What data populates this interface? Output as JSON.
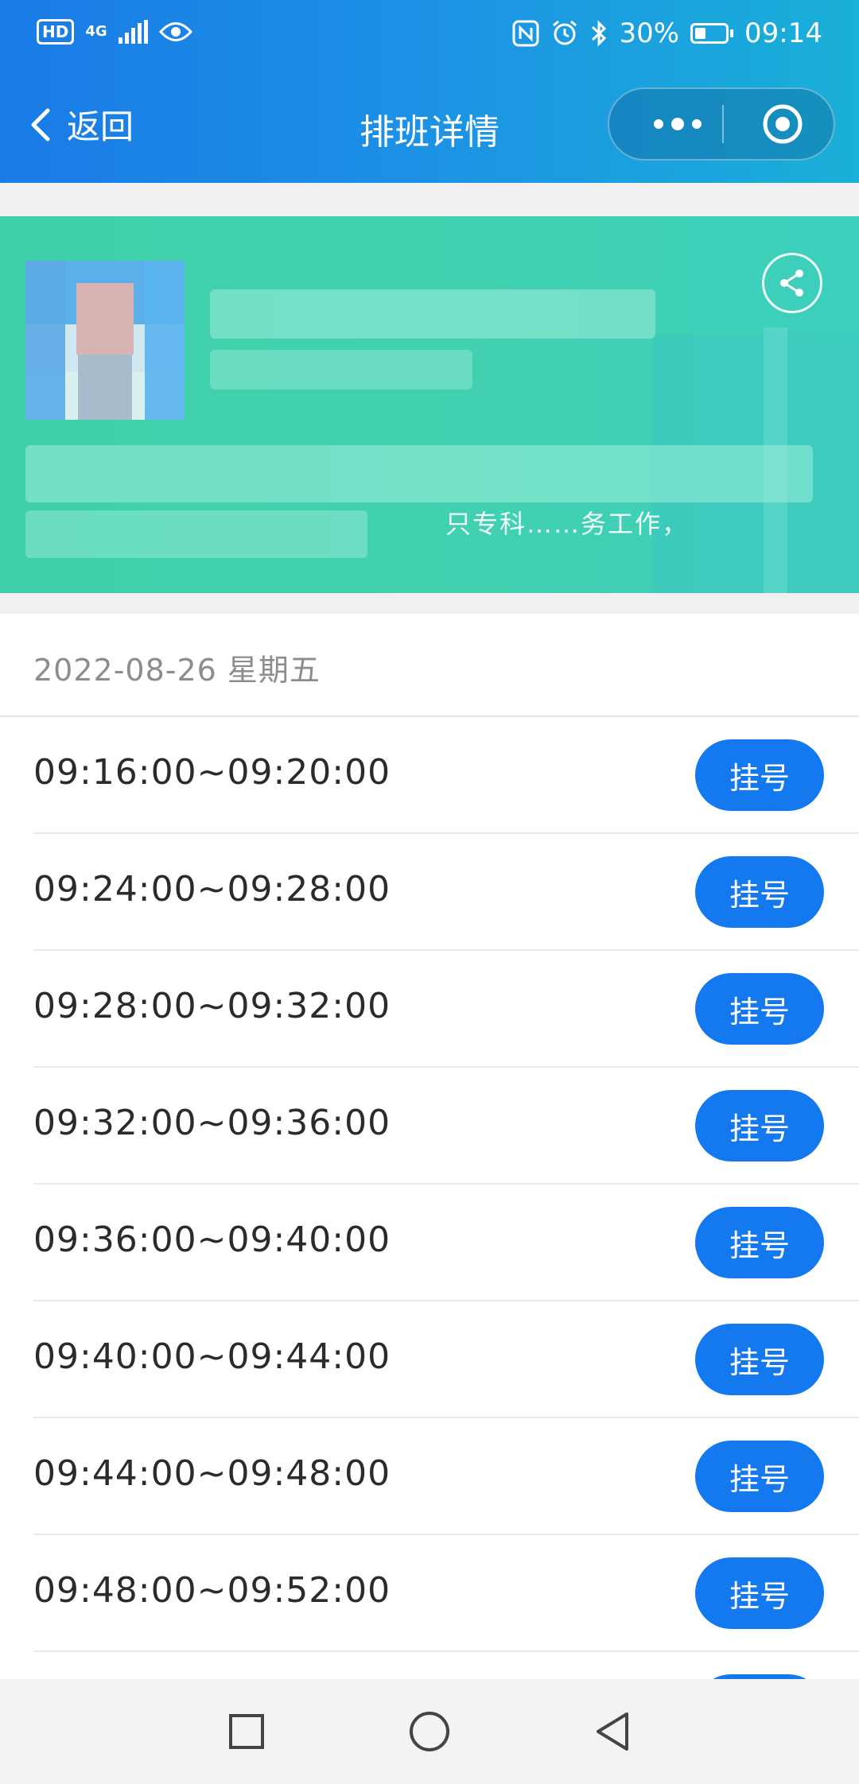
{
  "status_bar": {
    "hd": "HD",
    "network": "4G",
    "battery": "30%",
    "battery_level": 0.3,
    "time": "09:14"
  },
  "nav": {
    "back_label": "返回",
    "title": "排班详情"
  },
  "banner": {
    "partial_text": "只专科……务工作，",
    "colors": {
      "start": "#3fcfa8",
      "end": "#3ccfbd"
    }
  },
  "schedule": {
    "date": "2022-08-26 星期五",
    "slots": [
      {
        "time": "09:16:00~09:20:00",
        "action": "挂号"
      },
      {
        "time": "09:24:00~09:28:00",
        "action": "挂号"
      },
      {
        "time": "09:28:00~09:32:00",
        "action": "挂号"
      },
      {
        "time": "09:32:00~09:36:00",
        "action": "挂号"
      },
      {
        "time": "09:36:00~09:40:00",
        "action": "挂号"
      },
      {
        "time": "09:40:00~09:44:00",
        "action": "挂号"
      },
      {
        "time": "09:44:00~09:48:00",
        "action": "挂号"
      },
      {
        "time": "09:48:00~09:52:00",
        "action": "挂号"
      }
    ]
  },
  "colors": {
    "header_start": "#1a7be6",
    "header_end": "#1ab0d8",
    "button": "#1479ef",
    "date_text": "#8d8d8d"
  },
  "icons": {
    "back": "chevron-left-icon",
    "more": "more-dots-icon",
    "close_miniprogram": "target-circle-icon",
    "share": "share-icon",
    "sys_recent": "square-icon",
    "sys_home": "circle-icon",
    "sys_back": "triangle-back-icon"
  }
}
